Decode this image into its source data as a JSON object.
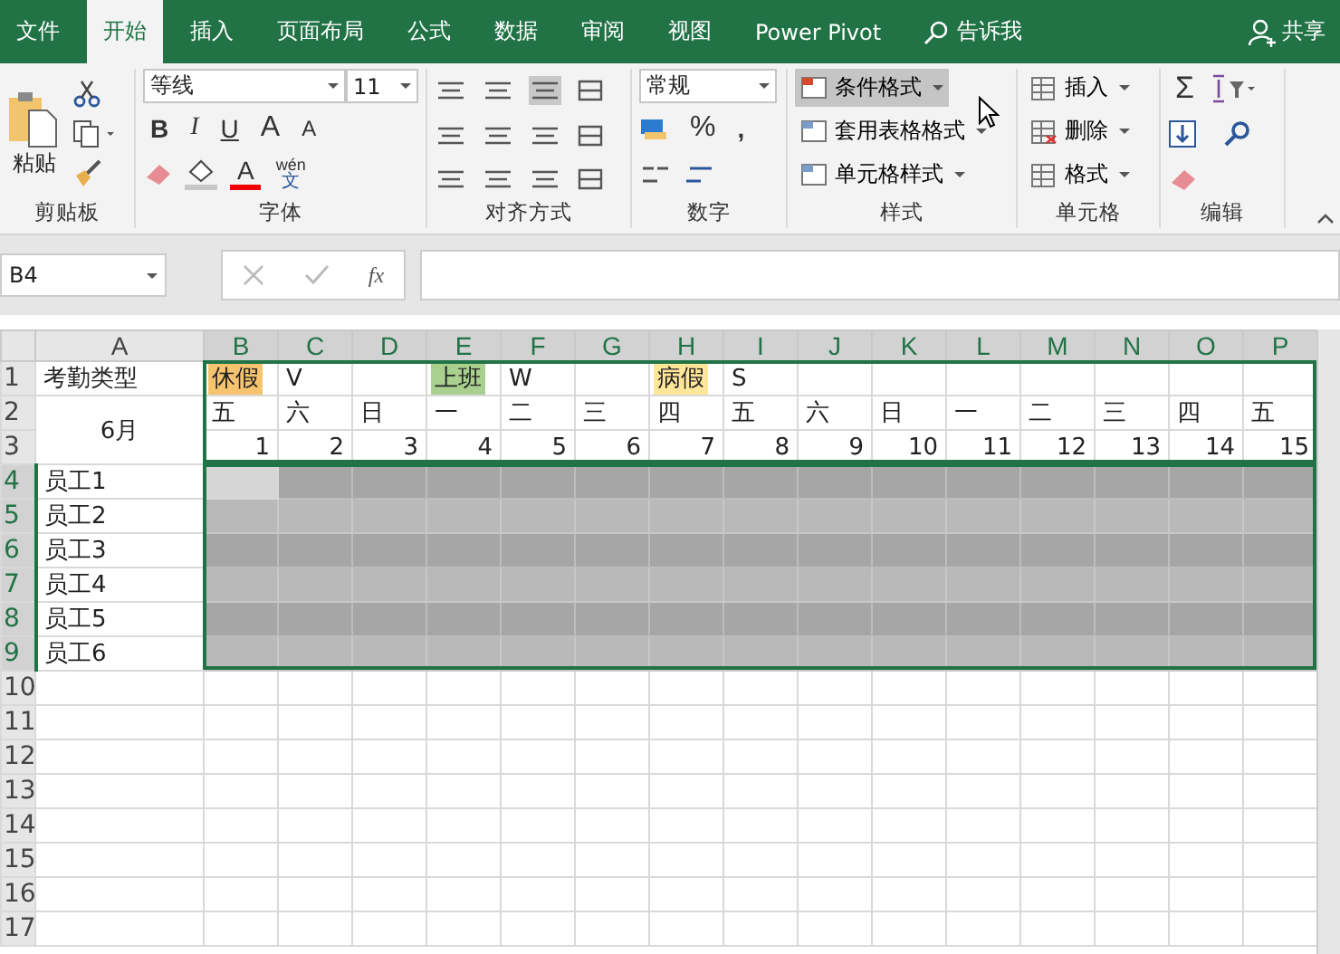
{
  "tabs": [
    {
      "label": "文件",
      "selected": false
    },
    {
      "label": "开始",
      "selected": true
    },
    {
      "label": "插入",
      "selected": false
    },
    {
      "label": "页面布局",
      "selected": false
    },
    {
      "label": "公式",
      "selected": false
    },
    {
      "label": "数据",
      "selected": false
    },
    {
      "label": "审阅",
      "selected": false
    },
    {
      "label": "视图",
      "selected": false
    },
    {
      "label": "Power Pivot",
      "selected": false
    }
  ],
  "tell_me": "告诉我",
  "share": "共享",
  "clipboard": {
    "paste": "粘贴",
    "label": "剪贴板"
  },
  "font": {
    "name": "等线",
    "size": "11",
    "bold": "B",
    "italic": "I",
    "underline": "U",
    "grow": "A",
    "shrink": "A",
    "color_letter": "A",
    "phonetic_top": "wén",
    "phonetic_bottom": "文",
    "label": "字体"
  },
  "alignment": {
    "label": "对齐方式"
  },
  "number": {
    "format": "常规",
    "percent": "%",
    "comma": ",",
    "label": "数字"
  },
  "styles": {
    "label": "样式",
    "items": [
      {
        "label": "条件格式",
        "selected": true
      },
      {
        "label": "套用表格格式",
        "selected": false
      },
      {
        "label": "单元格样式",
        "selected": false
      }
    ]
  },
  "cells": {
    "label": "单元格",
    "items": [
      "插入",
      "删除",
      "格式"
    ]
  },
  "editing": {
    "sum": "Σ",
    "label": "编辑"
  },
  "name_box": "B4",
  "fx": "fx",
  "sheet": {
    "columns": [
      {
        "label": "A",
        "selected": false
      },
      {
        "label": "B",
        "selected": true
      },
      {
        "label": "C",
        "selected": true
      },
      {
        "label": "D",
        "selected": true
      },
      {
        "label": "E",
        "selected": true
      },
      {
        "label": "F",
        "selected": true
      },
      {
        "label": "G",
        "selected": true
      },
      {
        "label": "H",
        "selected": true
      },
      {
        "label": "I",
        "selected": true
      },
      {
        "label": "J",
        "selected": true
      },
      {
        "label": "K",
        "selected": true
      },
      {
        "label": "L",
        "selected": true
      },
      {
        "label": "M",
        "selected": true
      },
      {
        "label": "N",
        "selected": true
      },
      {
        "label": "O",
        "selected": true
      },
      {
        "label": "P",
        "selected": true
      }
    ],
    "rows": [
      {
        "number": "1",
        "kind": "text",
        "selected": false,
        "outlined": true,
        "cells": [
          {
            "text": "考勤类型"
          },
          {
            "text": "休假",
            "color": "#f6c46f"
          },
          {
            "text": "V"
          },
          null,
          {
            "text": "上班",
            "color": "#a9d08e"
          },
          {
            "text": "W"
          },
          null,
          {
            "text": "病假",
            "color": "#ffe699"
          },
          {
            "text": "S"
          },
          null,
          null,
          null,
          null,
          null,
          null,
          null
        ]
      },
      {
        "number": "2",
        "kind": "text",
        "selected": false,
        "outlined": true,
        "cells": [
          {
            "text": "6月",
            "rowspan": 2
          },
          {
            "text": "五"
          },
          {
            "text": "六"
          },
          {
            "text": "日"
          },
          {
            "text": "一"
          },
          {
            "text": "二"
          },
          {
            "text": "三"
          },
          {
            "text": "四"
          },
          {
            "text": "五"
          },
          {
            "text": "六"
          },
          {
            "text": "日"
          },
          {
            "text": "一"
          },
          {
            "text": "二"
          },
          {
            "text": "三"
          },
          {
            "text": "四"
          },
          {
            "text": "五"
          }
        ]
      },
      {
        "number": "3",
        "kind": "number",
        "selected": false,
        "outlined": true,
        "cells": [
          {
            "text": "1"
          },
          {
            "text": "2"
          },
          {
            "text": "3"
          },
          {
            "text": "4"
          },
          {
            "text": "5"
          },
          {
            "text": "6"
          },
          {
            "text": "7"
          },
          {
            "text": "8"
          },
          {
            "text": "9"
          },
          {
            "text": "10"
          },
          {
            "text": "11"
          },
          {
            "text": "12"
          },
          {
            "text": "13"
          },
          {
            "text": "14"
          },
          {
            "text": "15"
          }
        ]
      },
      {
        "number": "4",
        "kind": "text",
        "selected": true,
        "cells": [
          {
            "text": "员工1"
          },
          {
            "active": true
          },
          null,
          null,
          null,
          null,
          null,
          null,
          null,
          null,
          null,
          null,
          null,
          null,
          null,
          null
        ]
      },
      {
        "number": "5",
        "kind": "text",
        "selected": true,
        "cells": [
          {
            "text": "员工2"
          },
          null,
          null,
          null,
          null,
          null,
          null,
          null,
          null,
          null,
          null,
          null,
          null,
          null,
          null,
          null
        ]
      },
      {
        "number": "6",
        "kind": "text",
        "selected": true,
        "cells": [
          {
            "text": "员工3"
          },
          null,
          null,
          null,
          null,
          null,
          null,
          null,
          null,
          null,
          null,
          null,
          null,
          null,
          null,
          null
        ]
      },
      {
        "number": "7",
        "kind": "text",
        "selected": true,
        "cells": [
          {
            "text": "员工4"
          },
          null,
          null,
          null,
          null,
          null,
          null,
          null,
          null,
          null,
          null,
          null,
          null,
          null,
          null,
          null
        ]
      },
      {
        "number": "8",
        "kind": "text",
        "selected": true,
        "cells": [
          {
            "text": "员工5"
          },
          null,
          null,
          null,
          null,
          null,
          null,
          null,
          null,
          null,
          null,
          null,
          null,
          null,
          null,
          null
        ]
      },
      {
        "number": "9",
        "kind": "text",
        "selected": true,
        "cells": [
          {
            "text": "员工6"
          },
          null,
          null,
          null,
          null,
          null,
          null,
          null,
          null,
          null,
          null,
          null,
          null,
          null,
          null,
          null
        ]
      },
      {
        "number": "10",
        "kind": "text",
        "selected": false,
        "cells": []
      },
      {
        "number": "11",
        "kind": "text",
        "selected": false,
        "cells": []
      },
      {
        "number": "12",
        "kind": "text",
        "selected": false,
        "cells": []
      },
      {
        "number": "13",
        "kind": "text",
        "selected": false,
        "cells": []
      },
      {
        "number": "14",
        "kind": "text",
        "selected": false,
        "cells": []
      },
      {
        "number": "15",
        "kind": "text",
        "selected": false,
        "cells": []
      },
      {
        "number": "16",
        "kind": "text",
        "selected": false,
        "cells": []
      },
      {
        "number": "17",
        "kind": "text",
        "selected": false,
        "cells": []
      }
    ]
  }
}
